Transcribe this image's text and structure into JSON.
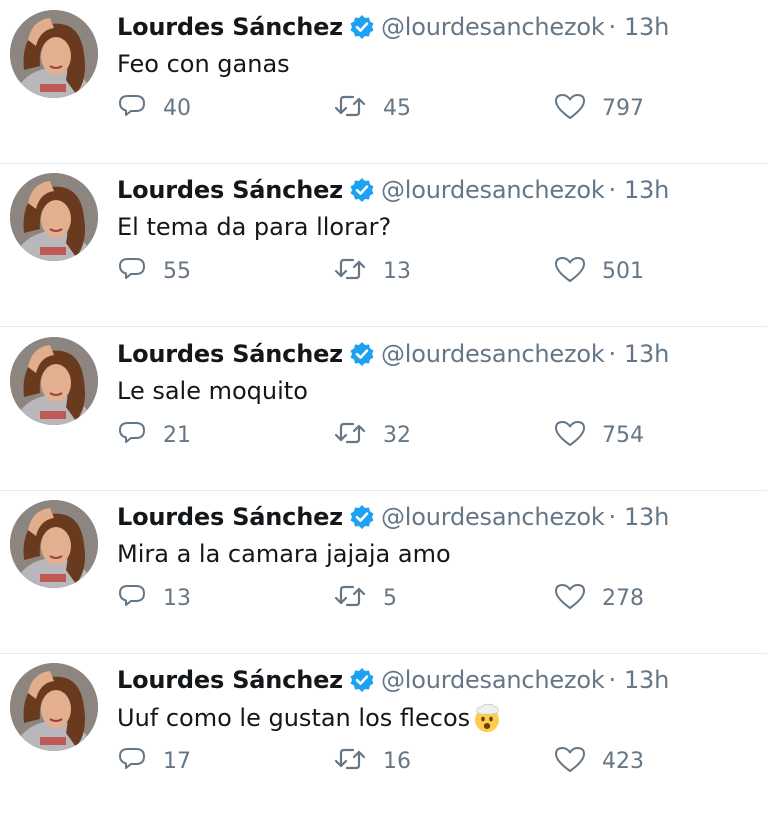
{
  "tweets": [
    {
      "name": "Lourdes Sánchez",
      "handle": "@lourdesanchezok",
      "dot": "·",
      "time": "13h",
      "text": "Feo con ganas",
      "replies": "40",
      "retweets": "45",
      "likes": "797"
    },
    {
      "name": "Lourdes Sánchez",
      "handle": "@lourdesanchezok",
      "dot": "·",
      "time": "13h",
      "text": "El tema da para llorar?",
      "replies": "55",
      "retweets": "13",
      "likes": "501"
    },
    {
      "name": "Lourdes Sánchez",
      "handle": "@lourdesanchezok",
      "dot": "·",
      "time": "13h",
      "text": "Le sale moquito",
      "replies": "21",
      "retweets": "32",
      "likes": "754"
    },
    {
      "name": "Lourdes Sánchez",
      "handle": "@lourdesanchezok",
      "dot": "·",
      "time": "13h",
      "text": "Mira a la camara jajaja amo",
      "replies": "13",
      "retweets": "5",
      "likes": "278"
    },
    {
      "name": "Lourdes Sánchez",
      "handle": "@lourdesanchezok",
      "dot": "·",
      "time": "13h",
      "text": "Uuf como le gustan los flecos",
      "emoji": "exploding-head-emoji",
      "replies": "17",
      "retweets": "16",
      "likes": "423"
    }
  ],
  "icons": {
    "verified": "verified-badge-icon",
    "reply": "reply-icon",
    "retweet": "retweet-icon",
    "like": "heart-icon"
  },
  "colors": {
    "name": "#14171a",
    "secondary": "#657786",
    "verified": "#1da1f2",
    "divider": "#e6ecf0"
  }
}
